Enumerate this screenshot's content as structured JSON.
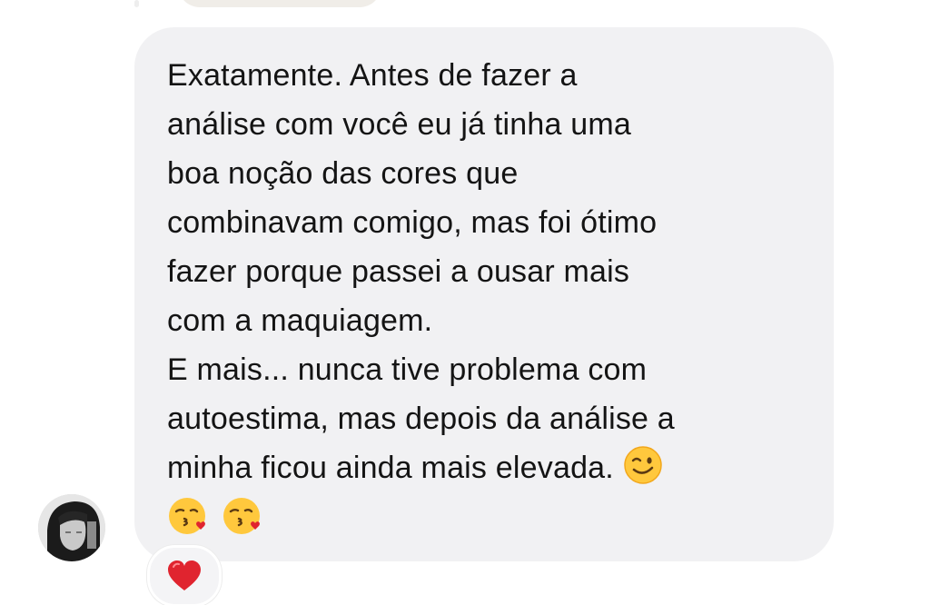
{
  "message": {
    "paragraphs": [
      {
        "lines": [
          "Exatamente. Antes de fazer a",
          "análise com você eu já tinha uma",
          "boa noção das cores que",
          "combinavam comigo, mas foi ótimo",
          "fazer porque passei a ousar mais",
          "com a maquiagem."
        ]
      },
      {
        "lines": [
          "E mais... nunca tive problema com",
          "autoestima, mas depois da análise a",
          "minha ficou ainda mais elevada."
        ]
      }
    ],
    "trailing_emoji": "winking-face",
    "extra_emojis": [
      "face-blowing-a-kiss",
      "face-blowing-a-kiss"
    ]
  },
  "sender": {
    "avatar_icon": "profile-photo"
  },
  "reaction": {
    "emoji": "red-heart"
  },
  "colors": {
    "bubble": "#f1f1f3",
    "text": "#141414",
    "heart": "#e0242f",
    "emoji_yellow": "#ffc83d"
  }
}
